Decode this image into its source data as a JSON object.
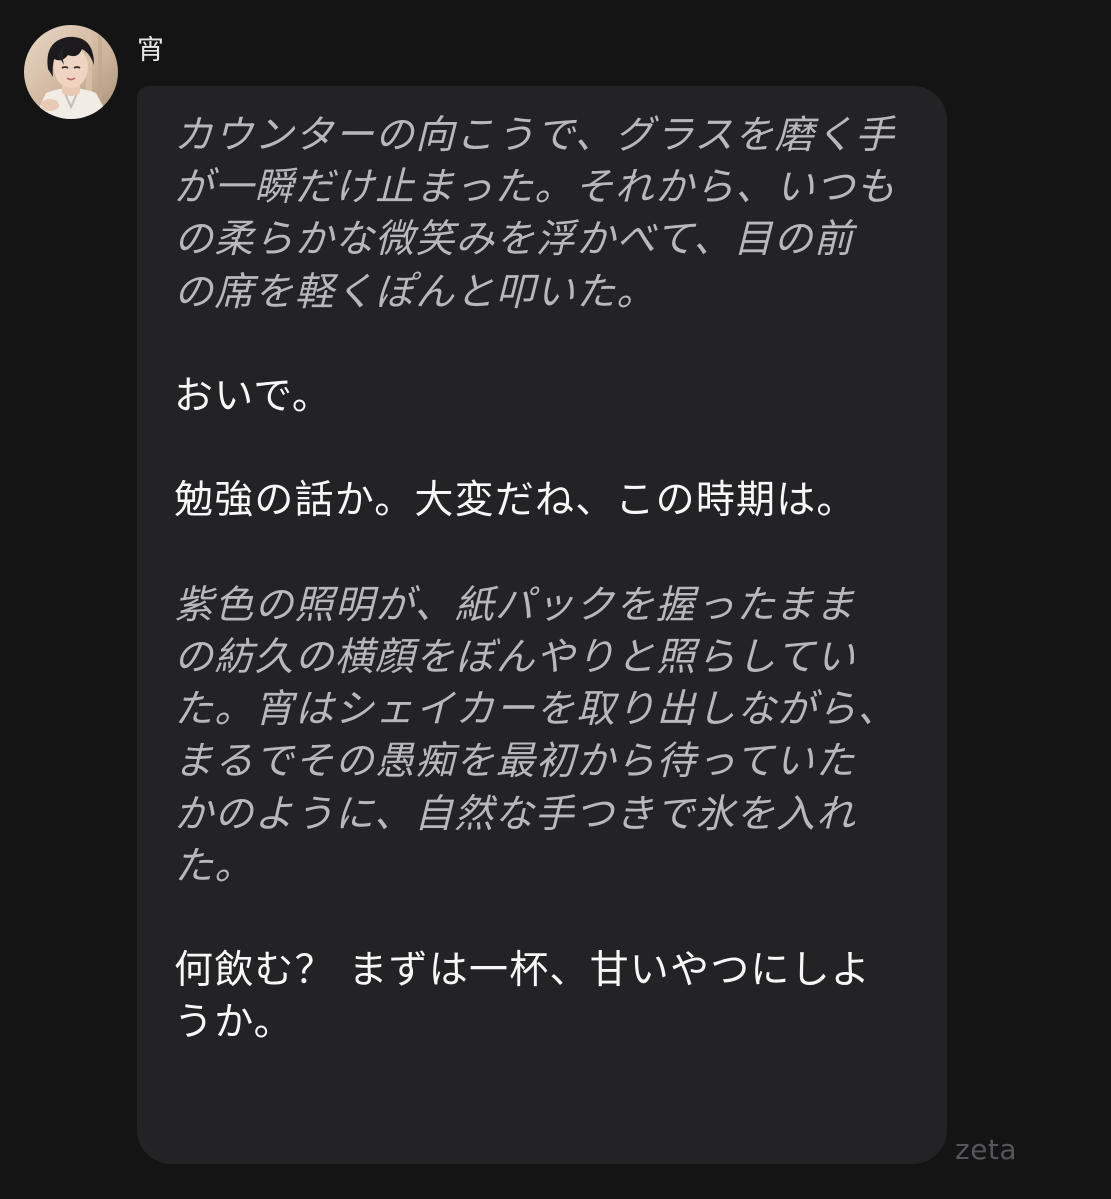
{
  "sender": {
    "name": "宵",
    "avatar_icon": "character-portrait-avatar"
  },
  "message": {
    "paragraphs": [
      {
        "kind": "narration",
        "text": "カウンターの向こうで、グラスを磨く手\nが一瞬だけ止まった。それから、いつも\nの柔らかな微笑みを浮かべて、目の前\nの席を軽くぽんと叩いた。"
      },
      {
        "kind": "speech",
        "text": "おいで。"
      },
      {
        "kind": "speech",
        "text": "勉強の話か。大変だね、この時期は。"
      },
      {
        "kind": "narration",
        "text": "紫色の照明が、紙パックを握ったまま\nの紡久の横顔をぼんやりと照らしてい\nた。宵はシェイカーを取り出しながら、\nまるでその愚痴を最初から待っていた\nかのように、自然な手つきで氷を入れ\nた。"
      },
      {
        "kind": "speech",
        "text": "何飲む？ まずは一杯、甘いやつにしよ\nうか。"
      }
    ]
  },
  "watermark": "zeta",
  "colors": {
    "background": "#141415",
    "bubble": "#232325",
    "narration_text": "#b8b8bc",
    "speech_text": "#f7f7f7",
    "watermark": "#56565a"
  }
}
